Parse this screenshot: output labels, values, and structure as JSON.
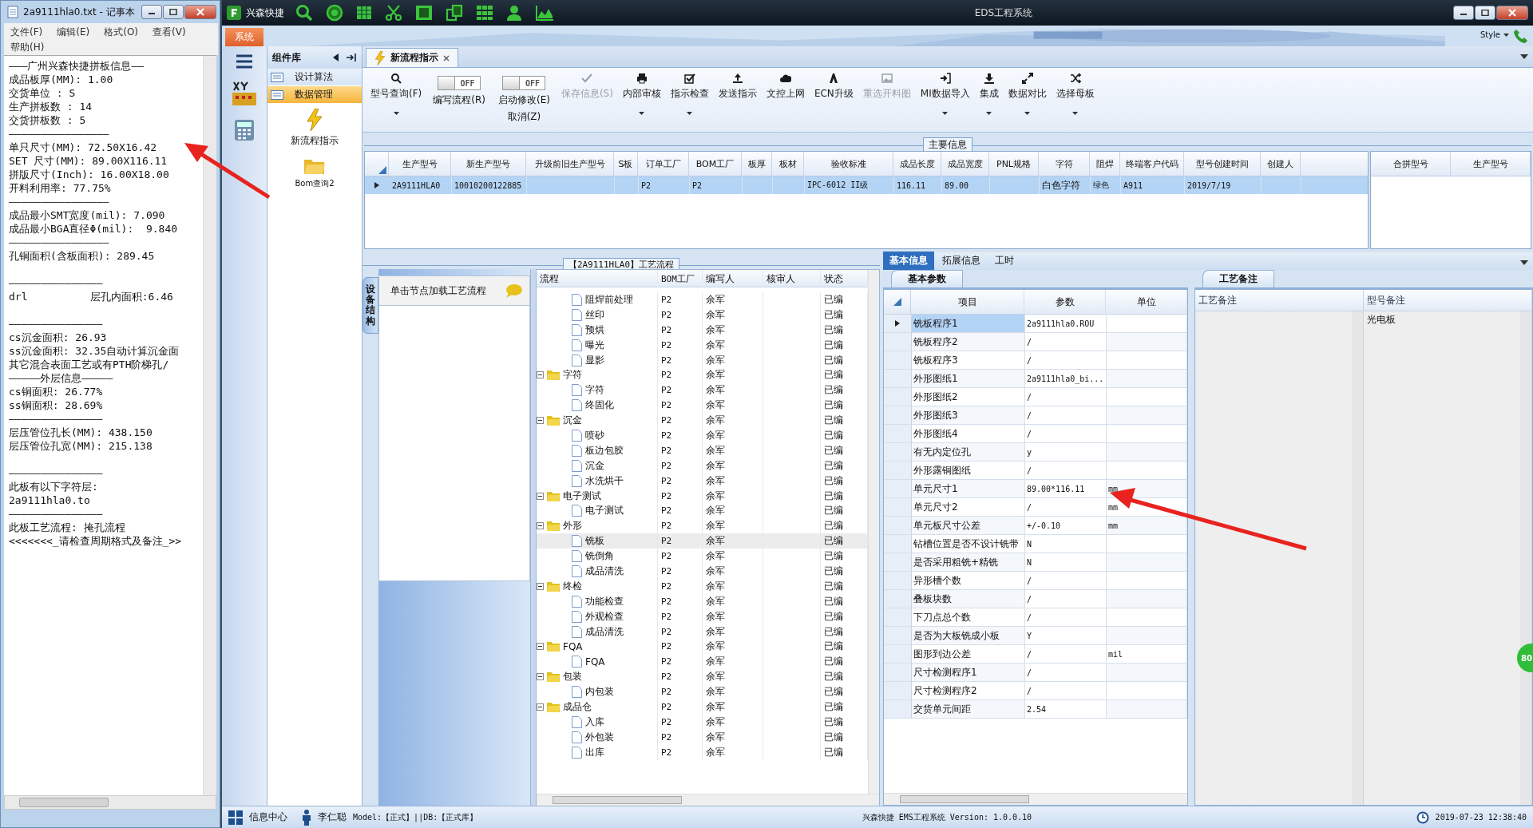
{
  "notepad": {
    "title": "2a9111hla0.txt - 记事本",
    "menu": [
      "文件(F)",
      "编辑(E)",
      "格式(O)",
      "查看(V)",
      "帮助(H)"
    ],
    "lines": [
      {
        "text": "———广州兴森快捷拼板信息——"
      },
      {
        "text": "成品板厚(MM): 1.00"
      },
      {
        "text": "交货单位 : S"
      },
      {
        "text": "生产拼板数 : 14"
      },
      {
        "text": "交货拼板数 : 5"
      },
      {
        "text": "————————————————"
      },
      {
        "text": "单只尺寸(MM): 72.50X16.42"
      },
      {
        "text": "SET 尺寸(MM): 89.00X116.11"
      },
      {
        "text": "拼版尺寸(Inch): 16.00X18.00"
      },
      {
        "text": "开料利用率: 77.75%"
      },
      {
        "text": "————————————————"
      },
      {
        "text": "成品最小SMT宽度(mil): 7.090"
      },
      {
        "text": "成品最小BGA直径Φ(mil):  9.840"
      },
      {
        "text": "————————————————"
      },
      {
        "text": "孔铜面积(含板面积): 289.45"
      },
      {
        "text": "———————————————",
        "gap_before": true
      },
      {
        "text": "drl          层孔内面积:6.46"
      },
      {
        "text": "———————————————",
        "gap_before": true
      },
      {
        "text": "cs沉金面积: 26.93"
      },
      {
        "text": "ss沉金面积: 32.35自动计算沉金面"
      },
      {
        "text": "其它混合表面工艺或有PTH阶梯孔/"
      },
      {
        "text": "—————外层信息—————"
      },
      {
        "text": "cs铜面积: 26.77%"
      },
      {
        "text": "ss铜面积: 28.69%"
      },
      {
        "text": "———————————————"
      },
      {
        "text": "层压管位孔长(MM): 438.150"
      },
      {
        "text": "层压管位孔宽(MM): 215.138"
      },
      {
        "text": "———————————————",
        "gap_before": true
      },
      {
        "text": "此板有以下字符层:"
      },
      {
        "text": "2a9111hla0.to"
      },
      {
        "text": "———————————————"
      },
      {
        "text": "此板工艺流程: 掩孔流程"
      },
      {
        "text": "<<<<<<<_请检查周期格式及备注_>>"
      }
    ]
  },
  "window": {
    "app_name": "兴森快捷",
    "title": "EDS工程系统",
    "ribbon_tab": "系统",
    "style_menu": "Style"
  },
  "component_library": {
    "title": "组件库",
    "items": [
      {
        "label": "设计算法",
        "selected": false
      },
      {
        "label": "数据管理",
        "selected": true
      }
    ],
    "tools": [
      "新流程指示",
      "Bom查询2"
    ]
  },
  "doc_tab": {
    "label": "新流程指示",
    "selected": true
  },
  "toolbar": [
    {
      "kind": "button",
      "label": "型号查询(F)",
      "disabled": false,
      "dropdown": true
    },
    {
      "kind": "toggle",
      "label": "编写流程(R)",
      "state": "OFF",
      "on": false
    },
    {
      "kind": "toggle",
      "label": "启动修改(E)",
      "sublabel": "取消(Z)",
      "state": "OFF",
      "on": false
    },
    {
      "kind": "button",
      "label": "保存信息(S)",
      "disabled": true,
      "dropdown": false
    },
    {
      "kind": "button",
      "label": "内部审核",
      "disabled": false,
      "dropdown": true
    },
    {
      "kind": "button",
      "label": "指示检查",
      "disabled": false,
      "dropdown": true
    },
    {
      "kind": "button",
      "label": "发送指示",
      "disabled": false,
      "dropdown": false
    },
    {
      "kind": "button",
      "label": "文控上网",
      "disabled": false,
      "dropdown": false
    },
    {
      "kind": "button",
      "label": "ECN升级",
      "disabled": false,
      "dropdown": false
    },
    {
      "kind": "button",
      "label": "重选开料图",
      "disabled": true,
      "dropdown": false
    },
    {
      "kind": "button",
      "label": "MI数据导入",
      "disabled": false,
      "dropdown": true
    },
    {
      "kind": "button",
      "label": "集成",
      "disabled": false,
      "dropdown": true
    },
    {
      "kind": "button",
      "label": "数据对比",
      "disabled": false,
      "dropdown": true
    },
    {
      "kind": "button",
      "label": "选择母板",
      "disabled": false,
      "dropdown": true
    }
  ],
  "main_info": {
    "title": "主要信息",
    "columns": [
      "生产型号",
      "新生产型号",
      "升级前旧生产型号",
      "S板",
      "订单工厂",
      "BOM工厂",
      "板厚",
      "板材",
      "验收标准",
      "成品长度",
      "成品宽度",
      "PNL规格",
      "字符",
      "阻焊",
      "终端客户代码",
      "型号创建时间",
      "创建人"
    ],
    "rows": [
      {
        "selected": true,
        "cells": [
          "2A9111HLA0",
          "10010200122885",
          "",
          "",
          "P2",
          "P2",
          "",
          "",
          "IPC-6012 II级",
          "116.11",
          "89.00",
          "",
          "白色字符",
          "绿色",
          "A911",
          "2019/7/19",
          ""
        ]
      }
    ],
    "side_columns": [
      "合拼型号",
      "生产型号"
    ]
  },
  "process": {
    "title": "【2A9111HLA0】工艺流程",
    "side_tab": "设备结构",
    "hint": "单击节点加载工艺流程",
    "columns": [
      "流程",
      "BOM工厂",
      "编写人",
      "核审人",
      "状态"
    ],
    "tree": [
      {
        "children": [
          {
            "label": "阻焊前处理",
            "bom": "P2",
            "writer": "余军",
            "status": "已编",
            "selected": false
          },
          {
            "label": "丝印",
            "bom": "P2",
            "writer": "余军",
            "status": "已编",
            "selected": false
          },
          {
            "label": "预烘",
            "bom": "P2",
            "writer": "余军",
            "status": "已编",
            "selected": false
          },
          {
            "label": "曝光",
            "bom": "P2",
            "writer": "余军",
            "status": "已编",
            "selected": false
          },
          {
            "label": "显影",
            "bom": "P2",
            "writer": "余军",
            "status": "已编",
            "selected": false
          }
        ]
      },
      {
        "label": "字符",
        "bom": "P2",
        "writer": "余军",
        "status": "已编",
        "selected": false,
        "expanded": true,
        "children": [
          {
            "label": "字符",
            "bom": "P2",
            "writer": "余军",
            "status": "已编",
            "selected": false
          },
          {
            "label": "终固化",
            "bom": "P2",
            "writer": "余军",
            "status": "已编",
            "selected": false
          }
        ]
      },
      {
        "label": "沉金",
        "bom": "P2",
        "writer": "余军",
        "status": "已编",
        "selected": false,
        "expanded": true,
        "children": [
          {
            "label": "喷砂",
            "bom": "P2",
            "writer": "余军",
            "status": "已编",
            "selected": false
          },
          {
            "label": "板边包胶",
            "bom": "P2",
            "writer": "余军",
            "status": "已编",
            "selected": false
          },
          {
            "label": "沉金",
            "bom": "P2",
            "writer": "余军",
            "status": "已编",
            "selected": false
          },
          {
            "label": "水洗烘干",
            "bom": "P2",
            "writer": "余军",
            "status": "已编",
            "selected": false
          }
        ]
      },
      {
        "label": "电子测试",
        "bom": "P2",
        "writer": "余军",
        "status": "已编",
        "selected": false,
        "expanded": true,
        "children": [
          {
            "label": "电子测试",
            "bom": "P2",
            "writer": "余军",
            "status": "已编",
            "selected": false
          }
        ]
      },
      {
        "label": "外形",
        "bom": "P2",
        "writer": "余军",
        "status": "已编",
        "selected": false,
        "expanded": true,
        "children": [
          {
            "label": "铣板",
            "bom": "P2",
            "writer": "余军",
            "status": "已编",
            "selected": true
          },
          {
            "label": "铣倒角",
            "bom": "P2",
            "writer": "余军",
            "status": "已编",
            "selected": false
          },
          {
            "label": "成品清洗",
            "bom": "P2",
            "writer": "余军",
            "status": "已编",
            "selected": false
          }
        ]
      },
      {
        "label": "终检",
        "bom": "P2",
        "writer": "余军",
        "status": "已编",
        "selected": false,
        "expanded": true,
        "children": [
          {
            "label": "功能检查",
            "bom": "P2",
            "writer": "余军",
            "status": "已编",
            "selected": false
          },
          {
            "label": "外观检查",
            "bom": "P2",
            "writer": "余军",
            "status": "已编",
            "selected": false
          },
          {
            "label": "成品清洗",
            "bom": "P2",
            "writer": "余军",
            "status": "已编",
            "selected": false
          }
        ]
      },
      {
        "label": "FQA",
        "bom": "P2",
        "writer": "余军",
        "status": "已编",
        "selected": false,
        "expanded": true,
        "children": [
          {
            "label": "FQA",
            "bom": "P2",
            "writer": "余军",
            "status": "已编",
            "selected": false
          }
        ]
      },
      {
        "label": "包装",
        "bom": "P2",
        "writer": "余军",
        "status": "已编",
        "selected": false,
        "expanded": true,
        "children": [
          {
            "label": "内包装",
            "bom": "P2",
            "writer": "余军",
            "status": "已编",
            "selected": false
          }
        ]
      },
      {
        "label": "成品仓",
        "bom": "P2",
        "writer": "余军",
        "status": "已编",
        "selected": false,
        "expanded": true,
        "children": [
          {
            "label": "入库",
            "bom": "P2",
            "writer": "余军",
            "status": "已编",
            "selected": false
          },
          {
            "label": "外包装",
            "bom": "P2",
            "writer": "余军",
            "status": "已编",
            "selected": false
          },
          {
            "label": "出库",
            "bom": "P2",
            "writer": "余军",
            "status": "已编",
            "selected": false
          }
        ]
      }
    ]
  },
  "info_tabs": [
    {
      "label": "基本信息",
      "selected": true
    },
    {
      "label": "拓展信息",
      "selected": false
    },
    {
      "label": "工时",
      "selected": false
    }
  ],
  "params": {
    "tab": "基本参数",
    "columns": [
      "项目",
      "参数",
      "单位"
    ],
    "rows": [
      {
        "item": "铣板程序1",
        "value": "2a9111hla0.ROU",
        "selected": true
      },
      {
        "item": "铣板程序2",
        "value": "/",
        "selected": false
      },
      {
        "item": "铣板程序3",
        "value": "/",
        "selected": false
      },
      {
        "item": "外形图纸1",
        "value": "2a9111hla0_bi...",
        "selected": false
      },
      {
        "item": "外形图纸2",
        "value": "/",
        "selected": false
      },
      {
        "item": "外形图纸3",
        "value": "/",
        "selected": false
      },
      {
        "item": "外形图纸4",
        "value": "/",
        "selected": false
      },
      {
        "item": "有无内定位孔",
        "value": "y",
        "selected": false
      },
      {
        "item": "外形露铜图纸",
        "value": "/",
        "selected": false
      },
      {
        "item": "单元尺寸1",
        "value": "89.00*116.11",
        "unit": "mm",
        "selected": false
      },
      {
        "item": "单元尺寸2",
        "value": "/",
        "unit": "mm",
        "selected": false
      },
      {
        "item": "单元板尺寸公差",
        "value": "+/-0.10",
        "unit": "mm",
        "selected": false
      },
      {
        "item": "钻槽位置是否不设计铣带",
        "value": "N",
        "selected": false
      },
      {
        "item": "是否采用粗铣+精铣",
        "value": "N",
        "selected": false
      },
      {
        "item": "异形槽个数",
        "value": "/",
        "selected": false
      },
      {
        "item": "叠板块数",
        "value": "/",
        "selected": false
      },
      {
        "item": "下刀点总个数",
        "value": "/",
        "selected": false
      },
      {
        "item": "是否为大板铣成小板",
        "value": "Y",
        "selected": false
      },
      {
        "item": "图形到边公差",
        "value": "/",
        "unit": "mil",
        "selected": false
      },
      {
        "item": "尺寸检测程序1",
        "value": "/",
        "selected": false
      },
      {
        "item": "尺寸检测程序2",
        "value": "/",
        "selected": false
      },
      {
        "item": "交货单元间距",
        "value": "2.54",
        "selected": false
      }
    ]
  },
  "remarks": {
    "tab": "工艺备注",
    "columns": [
      "工艺备注",
      "型号备注"
    ],
    "model_remark": "光电板"
  },
  "badge": "80",
  "status_bar": {
    "info_center": "信息中心",
    "user": "李仁聪",
    "model": "Model:【正式】||DB:【正式库】",
    "version": "兴森快捷 EMS工程系统 Version: 1.0.0.10",
    "time": "2019-07-23 12:38:40"
  }
}
